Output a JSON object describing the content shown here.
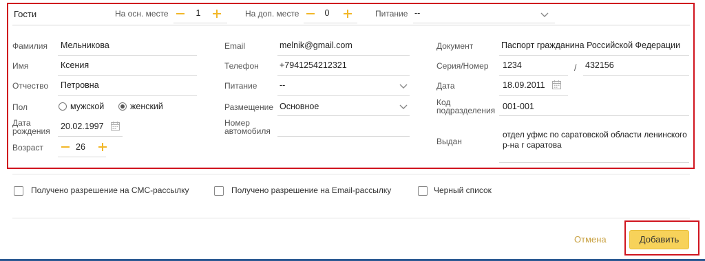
{
  "guests": {
    "title": "Гости",
    "main_place_label": "На осн. месте",
    "main_place_value": "1",
    "extra_place_label": "На доп. месте",
    "extra_place_value": "0",
    "meals_label": "Питание",
    "meals_value": "--"
  },
  "person": {
    "surname_label": "Фамилия",
    "surname": "Мельникова",
    "name_label": "Имя",
    "name": "Ксения",
    "patronymic_label": "Отчество",
    "patronymic": "Петровна",
    "gender_label": "Пол",
    "gender_male": "мужской",
    "gender_female": "женский",
    "gender_selected": "женский",
    "birthdate_label_1": "Дата",
    "birthdate_label_2": "рождения",
    "birthdate": "20.02.1997",
    "age_label": "Возраст",
    "age": "26"
  },
  "contact": {
    "email_label": "Email",
    "email": "melnik@gmail.com",
    "phone_label": "Телефон",
    "phone": "+7941254212321",
    "meals_label": "Питание",
    "meals": "--",
    "accommodation_label": "Размещение",
    "accommodation": "Основное",
    "car_label_1": "Номер",
    "car_label_2": "автомобиля",
    "car": ""
  },
  "document": {
    "doc_label": "Документ",
    "doc": "Паспорт гражданина Российской Федерации",
    "series_label": "Серия/Номер",
    "series": "1234",
    "separator": "/",
    "number": "432156",
    "date_label": "Дата",
    "date": "18.09.2011",
    "code_label_1": "Код",
    "code_label_2": "подразделения",
    "code": "001-001",
    "issued_label": "Выдан",
    "issued_line_1": "отдел уфмс по саратовской области ленинского",
    "issued_line_2": "р-на г саратова"
  },
  "consents": {
    "sms": "Получено разрешение на СМС-рассылку",
    "email": "Получено разрешение на Email-рассылку",
    "blacklist": "Черный список"
  },
  "actions": {
    "cancel": "Отмена",
    "add": "Добавить"
  },
  "colors": {
    "accent": "#f2b728",
    "highlight": "#d0141e",
    "button": "#f7d25a"
  }
}
